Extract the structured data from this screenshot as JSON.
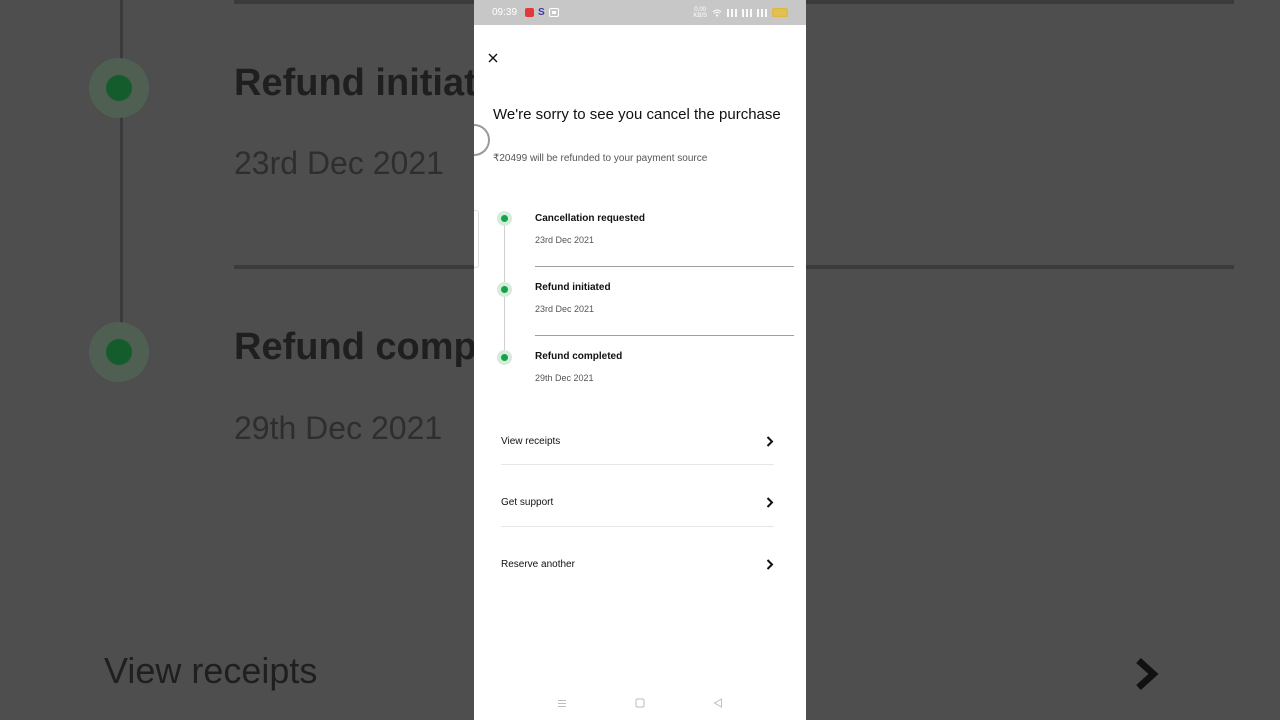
{
  "background": {
    "refund_initiated_fragment": "Refund initiat",
    "date_1": "23rd Dec 2021",
    "refund_completed_fragment": "Refund comp",
    "date_2": "29th Dec 2021",
    "view_receipts": "View receipts"
  },
  "status_bar": {
    "time": "09:39",
    "s_icon": "S",
    "speed_value": "0.00",
    "speed_unit": "KB/S",
    "battery_level": "57"
  },
  "header": {
    "close_icon": "close-icon",
    "title": "We're sorry to see you cancel the purchase",
    "subtitle": "₹20499 will be refunded to your payment source"
  },
  "timeline": {
    "items": [
      {
        "label": "Cancellation requested",
        "date": "23rd Dec 2021"
      },
      {
        "label": "Refund initiated",
        "date": "23rd Dec 2021"
      },
      {
        "label": "Refund completed",
        "date": "29th Dec 2021"
      }
    ]
  },
  "actions": {
    "items": [
      {
        "label": "View receipts",
        "icon": "chevron-right-icon"
      },
      {
        "label": "Get support",
        "icon": "chevron-right-icon"
      },
      {
        "label": "Reserve another",
        "icon": "chevron-right-icon"
      }
    ]
  },
  "colors": {
    "accent_green": "#14a34a",
    "dot_halo": "#d4ecd9",
    "status_bar_bg": "#c7c7c7",
    "backdrop": "#4e4e4e"
  }
}
